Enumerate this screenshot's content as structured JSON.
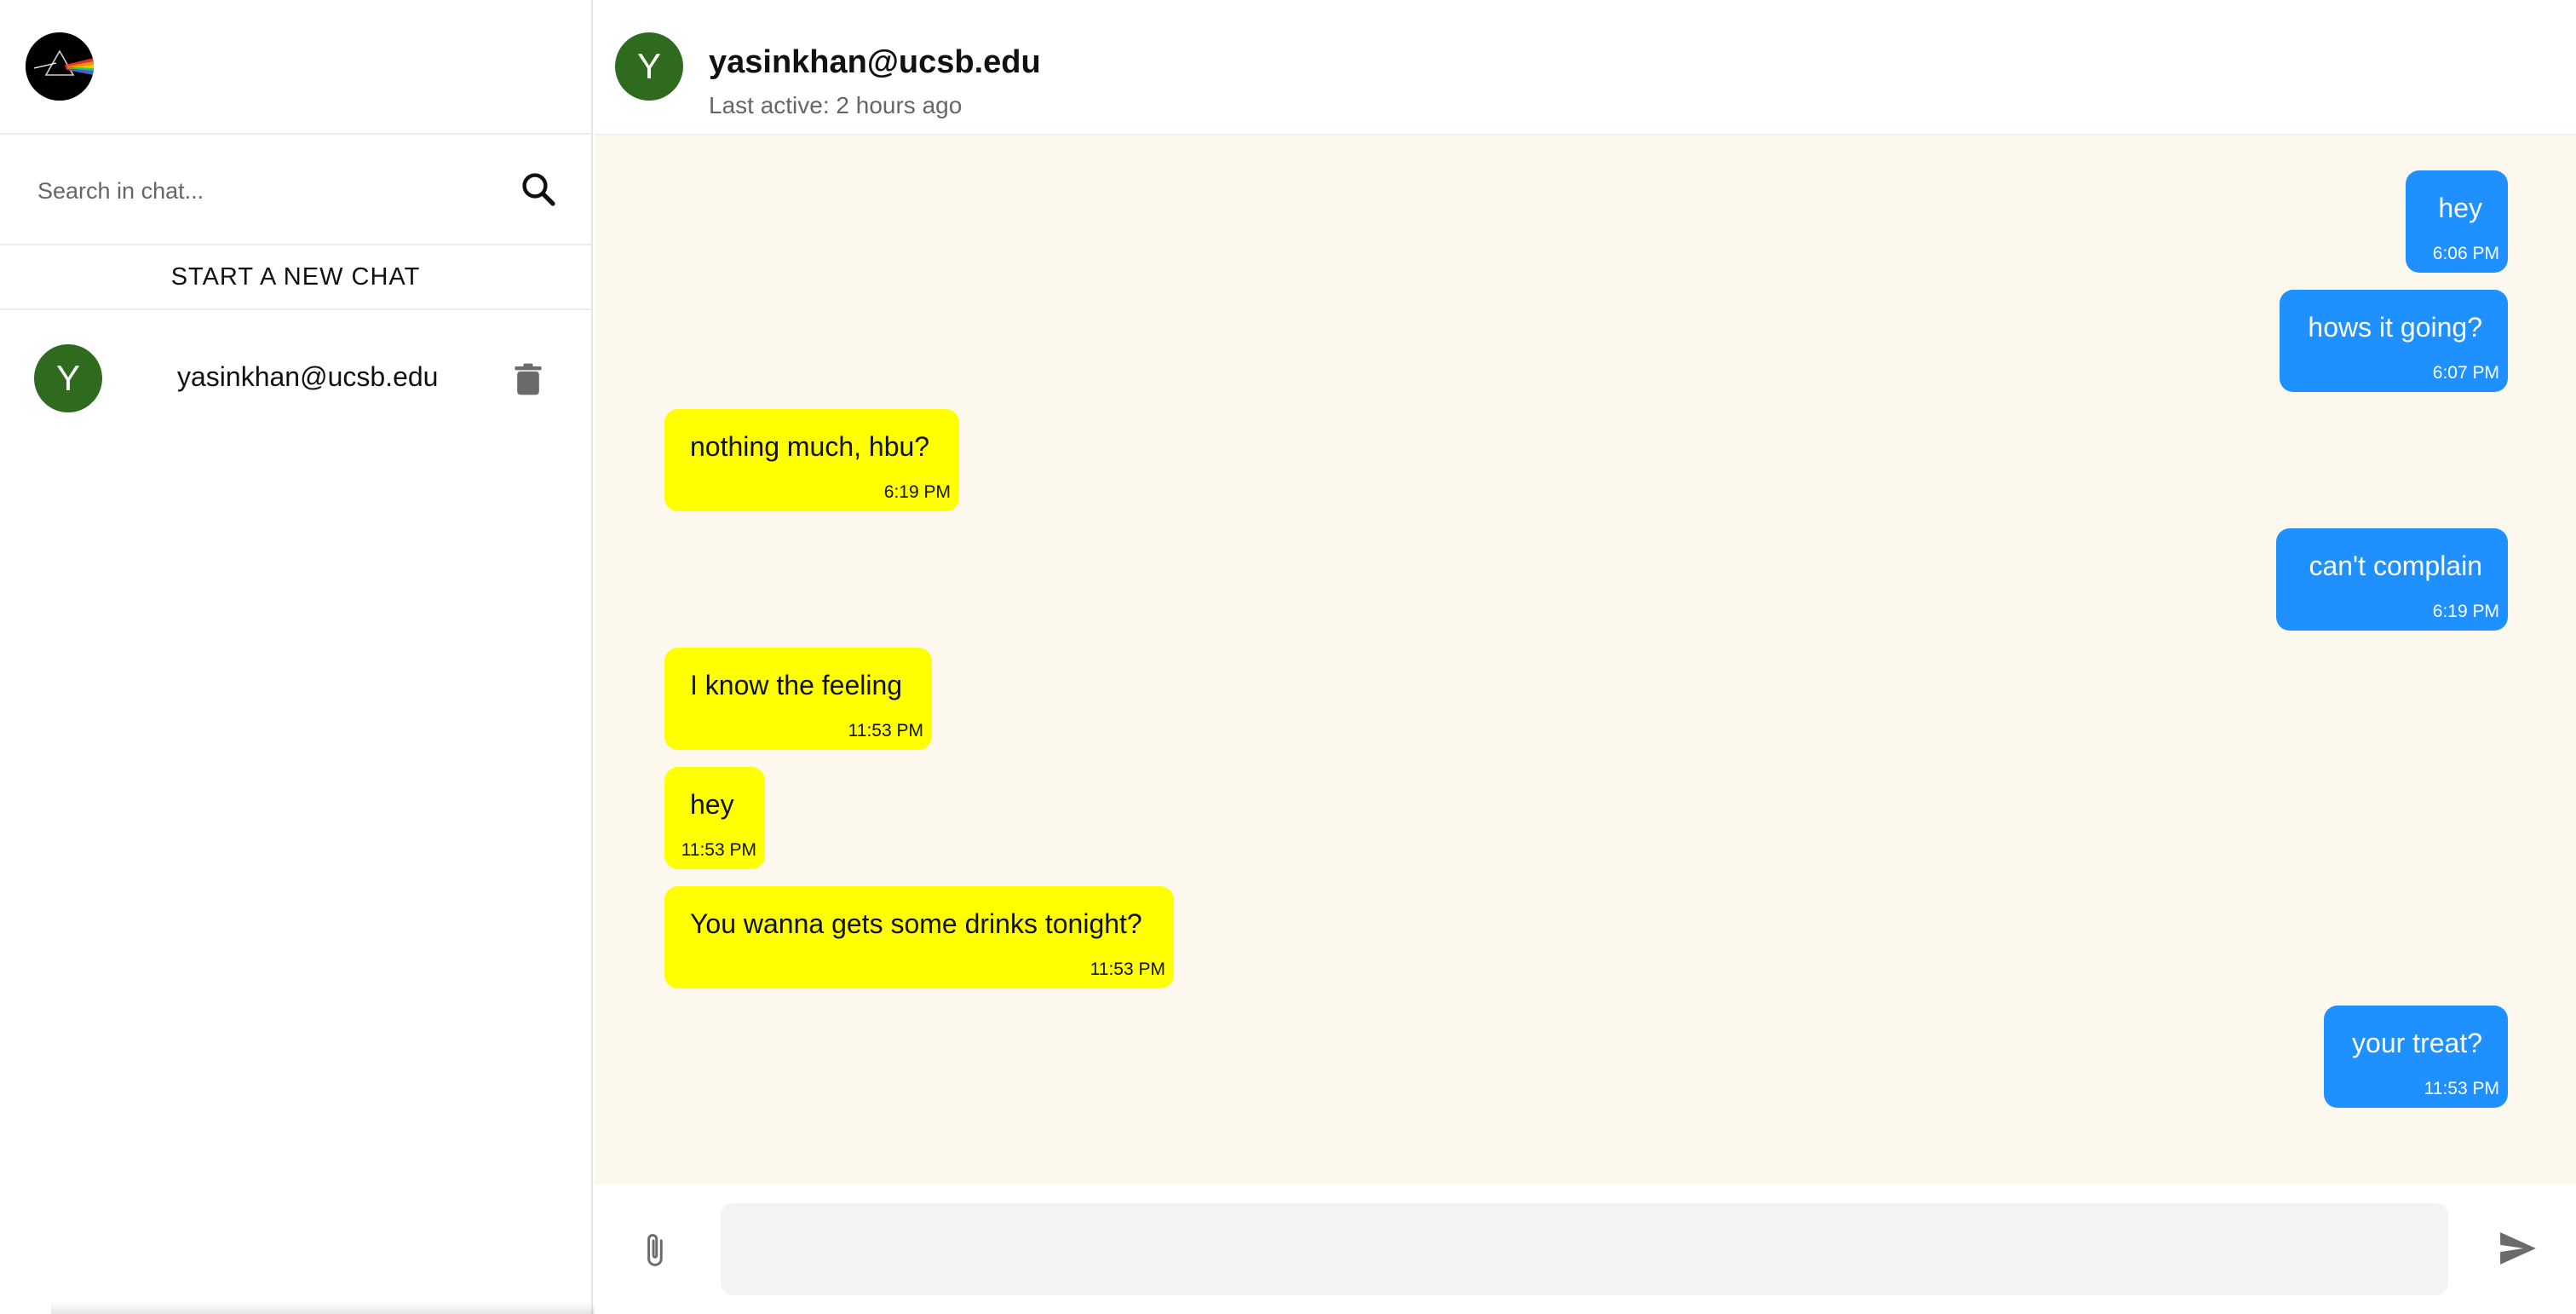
{
  "sidebar": {
    "search": {
      "placeholder": "Search in chat..."
    },
    "new_chat_label": "START A NEW CHAT",
    "chats": [
      {
        "avatar_letter": "Y",
        "name": "yasinkhan@ucsb.edu"
      }
    ]
  },
  "header": {
    "avatar_letter": "Y",
    "contact_name": "yasinkhan@ucsb.edu",
    "last_active": "Last active: 2 hours ago"
  },
  "messages": [
    {
      "direction": "outgoing",
      "text": "hey",
      "time": "6:06 PM"
    },
    {
      "direction": "outgoing",
      "text": "hows it going?",
      "time": "6:07 PM"
    },
    {
      "direction": "incoming",
      "text": "nothing much, hbu?",
      "time": "6:19 PM"
    },
    {
      "direction": "outgoing",
      "text": "can't complain",
      "time": "6:19 PM"
    },
    {
      "direction": "incoming",
      "text": "I know the feeling",
      "time": "11:53 PM"
    },
    {
      "direction": "incoming",
      "text": "hey",
      "time": "11:53 PM"
    },
    {
      "direction": "incoming",
      "text": "You wanna gets some drinks tonight?",
      "time": "11:53 PM"
    },
    {
      "direction": "outgoing",
      "text": "your treat?",
      "time": "11:53 PM"
    }
  ],
  "composer": {
    "placeholder": ""
  },
  "colors": {
    "outgoing_bubble": "#1e90ff",
    "incoming_bubble": "#ffff00",
    "avatar": "#2f6b1f",
    "chat_background": "#fcf8ee"
  },
  "icons": {
    "logo": "prism-logo-icon",
    "search": "search-icon",
    "trash": "trash-icon",
    "attach": "paperclip-icon",
    "send": "send-icon"
  }
}
